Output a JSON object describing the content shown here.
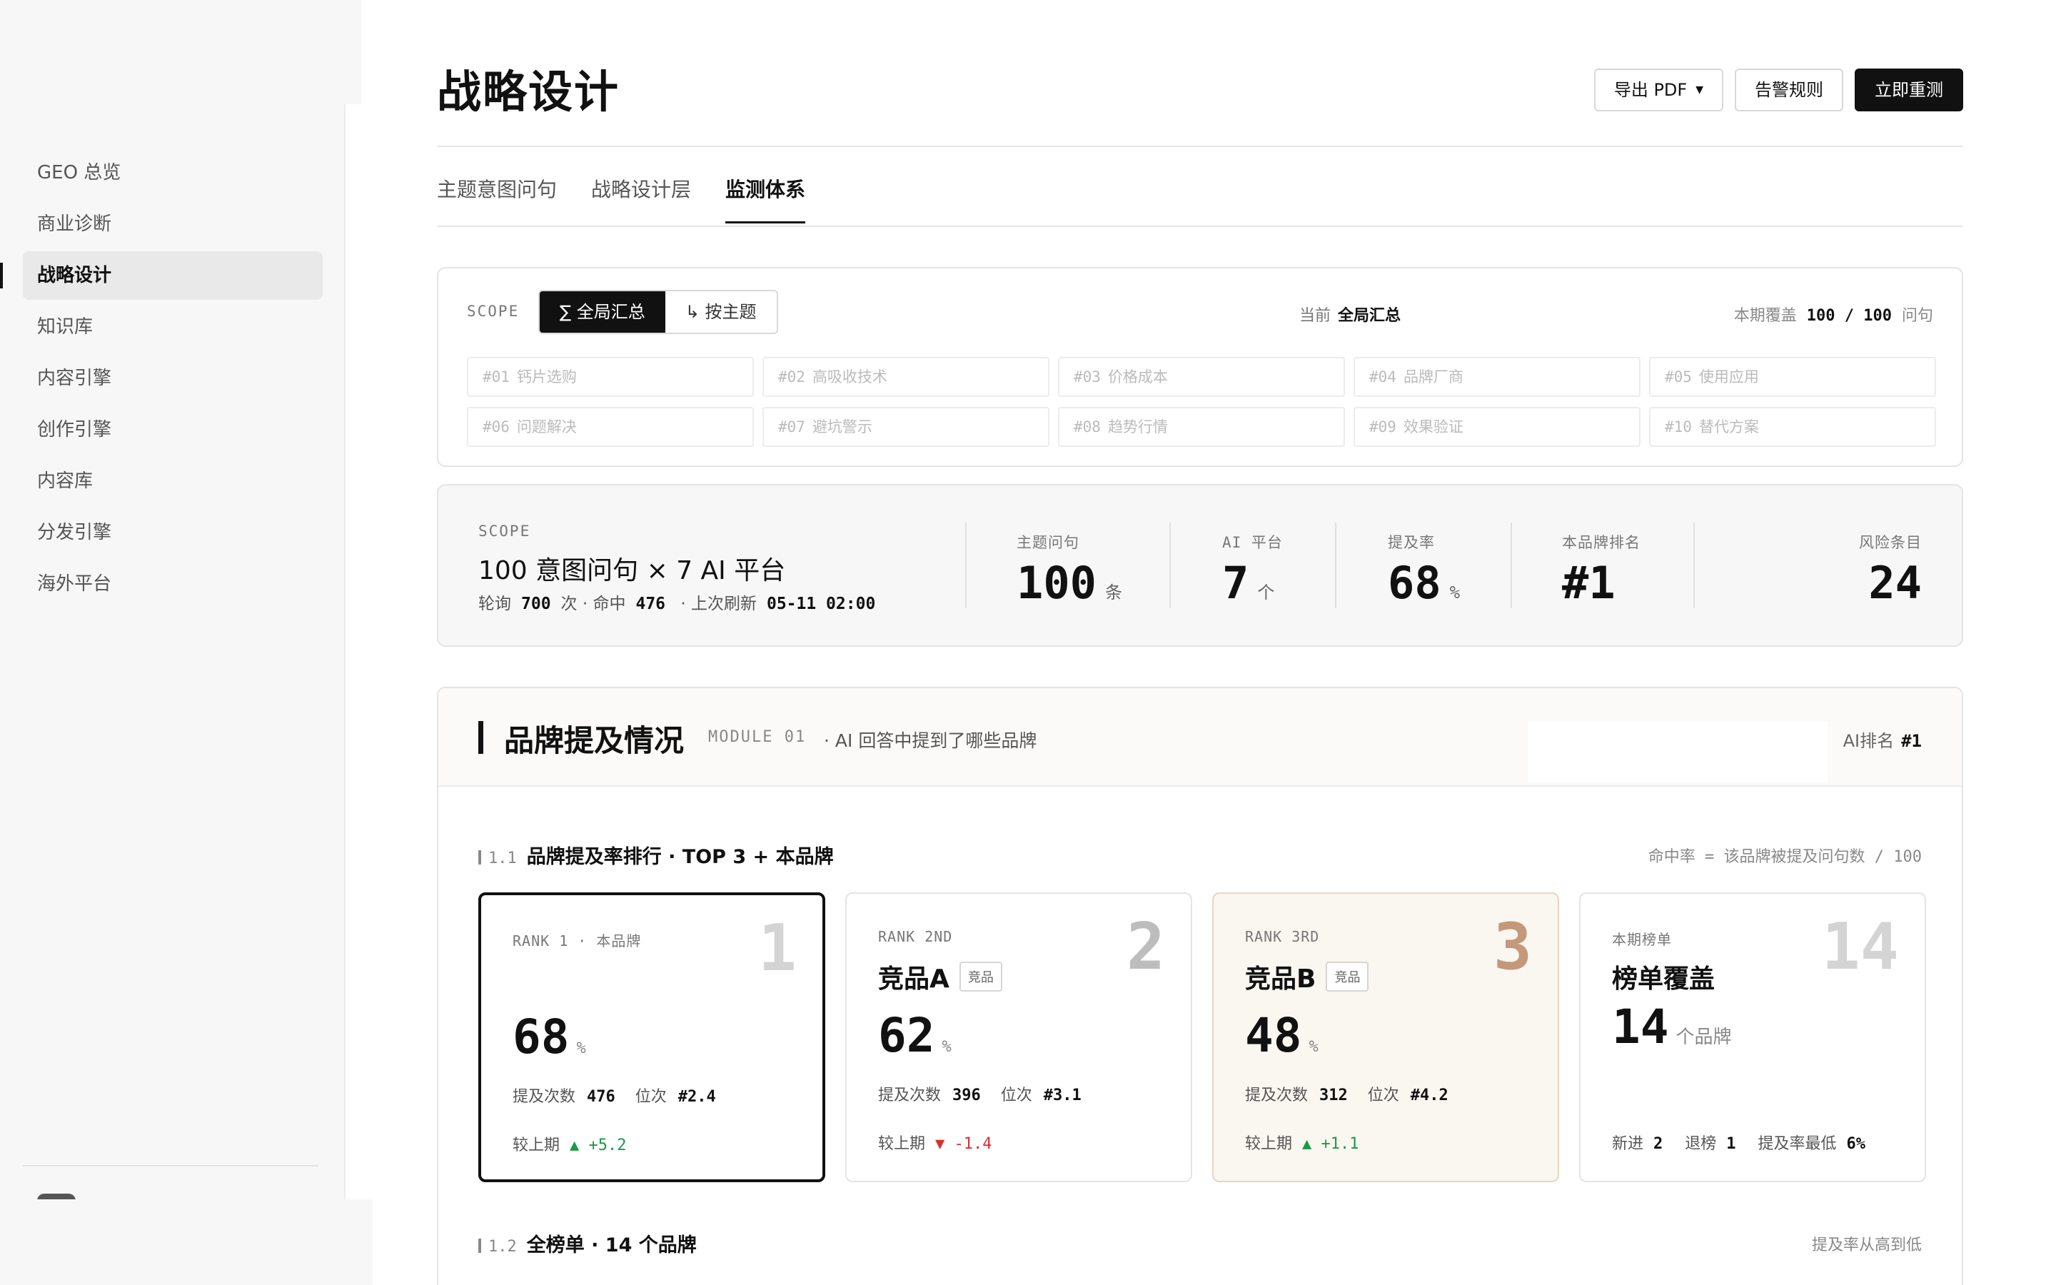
{
  "sidebar": {
    "items": [
      {
        "label": "GEO 总览"
      },
      {
        "label": "商业诊断"
      },
      {
        "label": "战略设计"
      },
      {
        "label": "知识库"
      },
      {
        "label": "内容引擎"
      },
      {
        "label": "创作引擎"
      },
      {
        "label": "内容库"
      },
      {
        "label": "分发引擎"
      },
      {
        "label": "海外平台"
      }
    ]
  },
  "header": {
    "title": "战略设计",
    "export_label": "导出 PDF",
    "alert_label": "告警规则",
    "retest_label": "立即重测"
  },
  "tabs": [
    {
      "label": "主题意图问句"
    },
    {
      "label": "战略设计层"
    },
    {
      "label": "监测体系"
    }
  ],
  "scope": {
    "label": "SCOPE",
    "seg_all": "∑ 全局汇总",
    "seg_topic": "↳ 按主题",
    "current_label": "当前",
    "current_value": "全局汇总",
    "coverage_label": "本期覆盖",
    "coverage_value": "100 / 100",
    "coverage_unit": "问句",
    "topics": [
      {
        "num": "#01",
        "name": "钙片选购"
      },
      {
        "num": "#02",
        "name": "高吸收技术"
      },
      {
        "num": "#03",
        "name": "价格成本"
      },
      {
        "num": "#04",
        "name": "品牌厂商"
      },
      {
        "num": "#05",
        "name": "使用应用"
      },
      {
        "num": "#06",
        "name": "问题解决"
      },
      {
        "num": "#07",
        "name": "避坑警示"
      },
      {
        "num": "#08",
        "name": "趋势行情"
      },
      {
        "num": "#09",
        "name": "效果验证"
      },
      {
        "num": "#10",
        "name": "替代方案"
      }
    ]
  },
  "summary": {
    "label": "SCOPE",
    "title": "100 意图问句 × 7 AI 平台",
    "poll_label": "轮询",
    "poll_value": "700",
    "poll_unit": "次 ·",
    "hit_label": "命中",
    "hit_value": "476",
    "refresh_label": "· 上次刷新",
    "refresh_value": "05-11 02:00",
    "stats": [
      {
        "label": "主题问句",
        "value": "100",
        "unit": "条"
      },
      {
        "label": "AI 平台",
        "value": "7",
        "unit": "个"
      },
      {
        "label": "提及率",
        "value": "68",
        "unit": "%"
      },
      {
        "label": "本品牌排名",
        "value": "#1",
        "unit": ""
      },
      {
        "label": "风险条目",
        "value": "24",
        "unit": ""
      }
    ]
  },
  "module": {
    "title": "品牌提及情况",
    "tag": "MODULE 01",
    "desc": "· AI 回答中提到了哪些品牌",
    "rank_label": "AI排名",
    "rank_value": "#1",
    "sec1_no": "1.1",
    "sec1_title": "品牌提及率排行 · TOP 3 + 本品牌",
    "sec1_note": "命中率 = 该品牌被提及问句数 / 100",
    "sec2_no": "1.2",
    "sec2_title": "全榜单 · 14 个品牌",
    "sec2_note": "提及率从高到低",
    "cards": [
      {
        "rank": "RANK 1 · 本品牌",
        "big": "1",
        "name": "",
        "badge": "",
        "value": "68",
        "unit": "%",
        "count_label": "提及次数",
        "count": "476",
        "pos_label": "位次",
        "pos": "#2.4",
        "delta_label": "较上期",
        "delta": "▲ +5.2"
      },
      {
        "rank": "RANK 2ND",
        "big": "2",
        "name": "竞品A",
        "badge": "竞品",
        "value": "62",
        "unit": "%",
        "count_label": "提及次数",
        "count": "396",
        "pos_label": "位次",
        "pos": "#3.1",
        "delta_label": "较上期",
        "delta": "▼ -1.4"
      },
      {
        "rank": "RANK 3RD",
        "big": "3",
        "name": "竞品B",
        "badge": "竞品",
        "value": "48",
        "unit": "%",
        "count_label": "提及次数",
        "count": "312",
        "pos_label": "位次",
        "pos": "#4.2",
        "delta_label": "较上期",
        "delta": "▲ +1.1"
      },
      {
        "rank": "本期榜单",
        "big": "14",
        "name": "榜单覆盖",
        "value": "14",
        "unit": "个品牌",
        "new_label": "新进",
        "new": "2",
        "out_label": "退榜",
        "out": "1",
        "min_label": "提及率最低",
        "min": "6%"
      }
    ]
  }
}
